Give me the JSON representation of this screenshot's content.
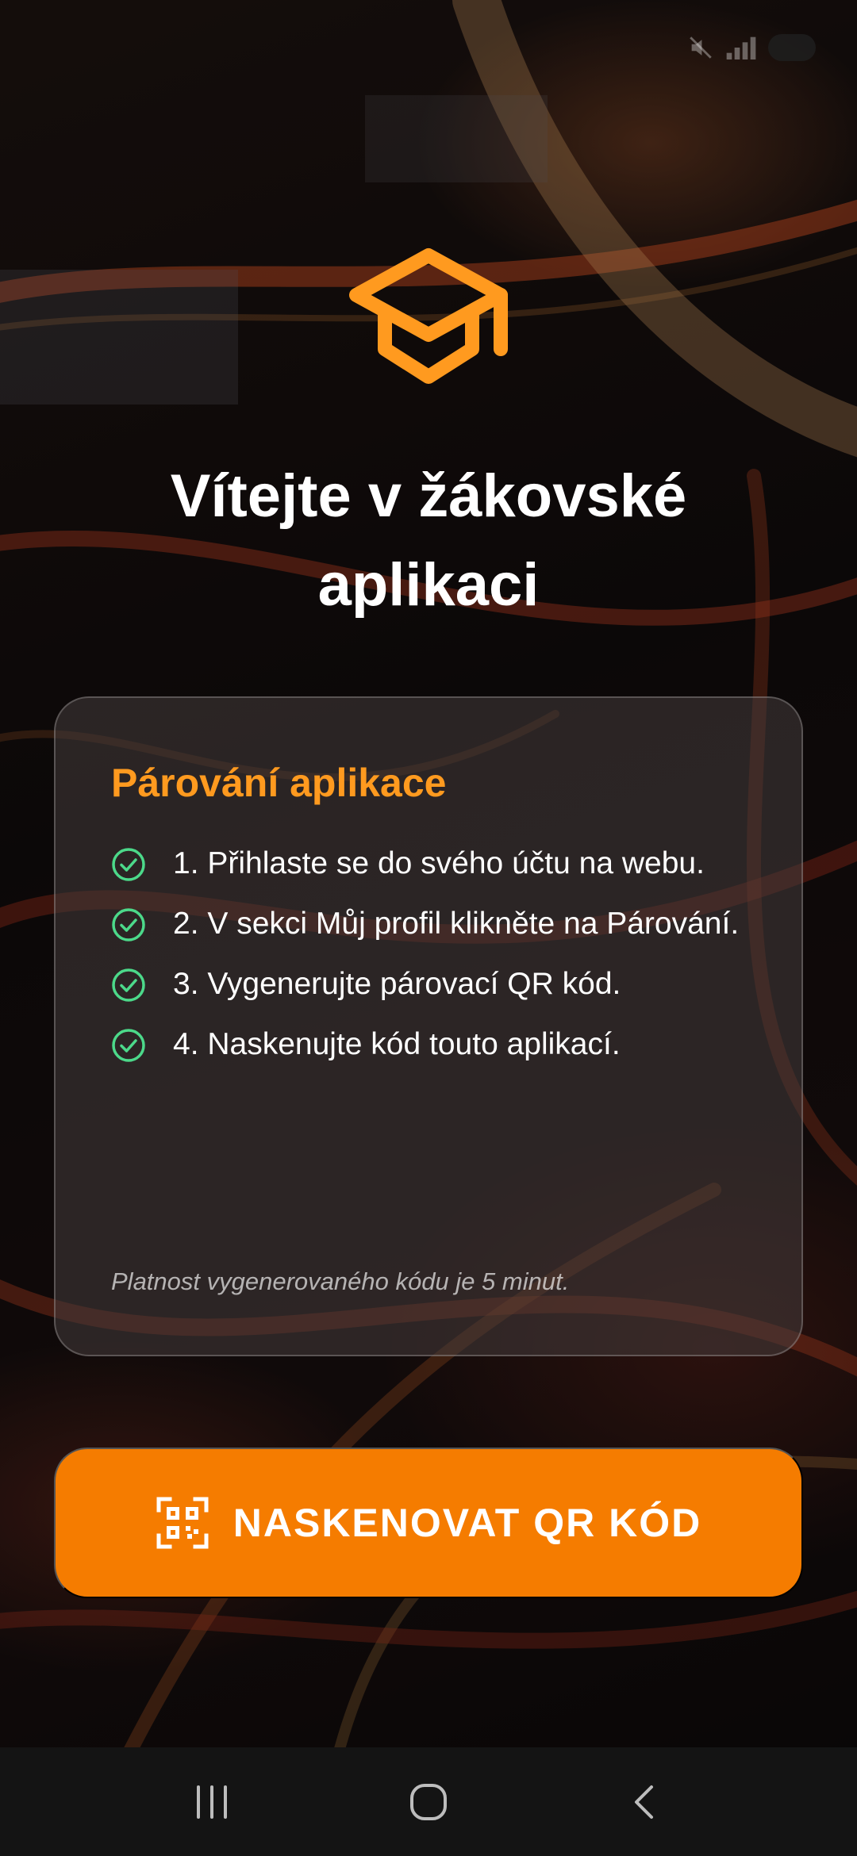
{
  "status_bar": {
    "time": "",
    "icons": [
      "mute-icon",
      "signal-icon",
      "battery-icon"
    ]
  },
  "welcome": {
    "title": "Vítejte v žákovské aplikaci",
    "logo_icon": "graduation-cap-icon"
  },
  "pairing_card": {
    "title": "Párování aplikace",
    "steps": [
      "1. Přihlaste se do svého účtu na webu.",
      "2. V sekci Můj profil klikněte na Párování.",
      "3. Vygenerujte párovací QR kód.",
      "4. Naskenujte kód touto aplikací."
    ],
    "note": "Platnost vygenerovaného kódu je 5 minut."
  },
  "scan_button": {
    "label": "NASKENOVAT QR KÓD",
    "icon": "qr-scan-icon"
  },
  "navigation": {
    "items": [
      "recent-apps-icon",
      "home-icon",
      "back-icon"
    ]
  },
  "colors": {
    "accent": "#f57c00",
    "card_title": "#ff9a1f",
    "check": "#4cd98a"
  }
}
